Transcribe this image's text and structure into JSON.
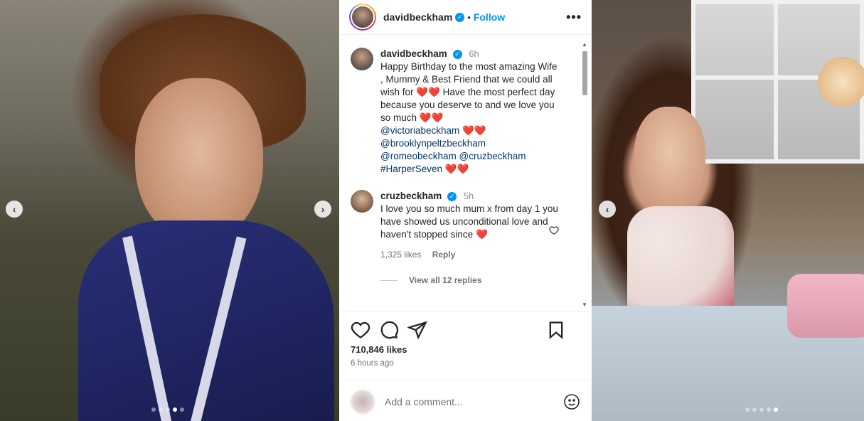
{
  "post": {
    "header": {
      "username": "davidbeckham",
      "separator": "•",
      "follow_label": "Follow",
      "more_label": "•••"
    },
    "caption": {
      "username": "davidbeckham",
      "time": "6h",
      "text": "Happy Birthday to the most amazing Wife , Mummy & Best Friend that we could all wish for ❤️❤️ Have the most perfect day because you deserve to and we love you so much ❤️❤️",
      "mention1": "@victoriabeckham",
      "mention1_suffix": " ❤️❤️",
      "mention2": "@brooklynpeltzbeckham",
      "mention3": "@romeobeckham",
      "mention4": "@cruzbeckham",
      "hashtag": "#HarperSeven",
      "hashtag_suffix": " ❤️❤️"
    },
    "comment": {
      "username": "cruzbeckham",
      "time": "5h",
      "text": "I love you so much mum x from day 1 you have showed us unconditional love and haven't stopped since",
      "emoji": "❤️",
      "likes": "1,325 likes",
      "reply_label": "Reply",
      "view_replies": "View all 12 replies"
    },
    "likes": "710,846 likes",
    "posted": "6 hours ago",
    "add_comment_placeholder": "Add a comment..."
  },
  "carousel": {
    "left_dots": 5,
    "left_active": 3,
    "right_dots": 5,
    "right_active": 4
  },
  "icons": {
    "prev": "chevron-left-icon",
    "next": "chevron-right-icon",
    "like": "heart-icon",
    "comment": "comment-icon",
    "share": "send-icon",
    "save": "bookmark-icon",
    "emoji": "emoji-icon"
  },
  "colors": {
    "accent": "#0095f6",
    "mention": "#00376b",
    "muted": "#737373"
  }
}
